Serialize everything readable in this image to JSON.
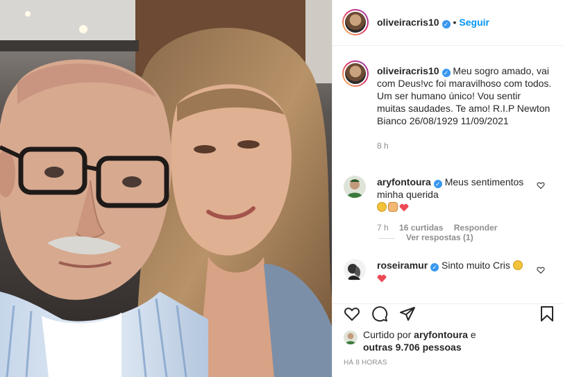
{
  "header": {
    "username": "oliveiracris10",
    "separator": "•",
    "follow_label": "Seguir"
  },
  "caption": {
    "username": "oliveiracris10",
    "text": "Meu sogro amado, vai com Deus!vc foi maravilhoso com todos. Um ser humano único! Vou sentir muitas saudades. Te amo! R.I.P Newton Bianco 26/08/1929 11/09/2021",
    "time": "8 h"
  },
  "comments": [
    {
      "username": "aryfontoura",
      "text": "Meus sentimentos minha querida",
      "emojis": [
        "sad-face",
        "raised-hands",
        "red-heart"
      ],
      "time": "7 h",
      "likes": "16 curtidas",
      "reply_label": "Responder",
      "view_replies": "Ver respostas (1)"
    },
    {
      "username": "roseiramur",
      "text": "Sinto muito Cris",
      "emojis": [
        "sad-face",
        "red-heart"
      ]
    }
  ],
  "actions": {
    "icons": [
      "heart-icon",
      "comment-icon",
      "share-icon",
      "bookmark-icon"
    ]
  },
  "likes": {
    "prefix": "Curtido por",
    "user": "aryfontoura",
    "connector": "e",
    "others": "outras 9.706 pessoas"
  },
  "timestamp": "HÁ 8 HORAS",
  "colors": {
    "link_blue": "#0095f6",
    "verified_blue": "#3897f0",
    "text_primary": "#262626",
    "text_secondary": "#8e8e8e",
    "heart_red": "#ed4956"
  }
}
